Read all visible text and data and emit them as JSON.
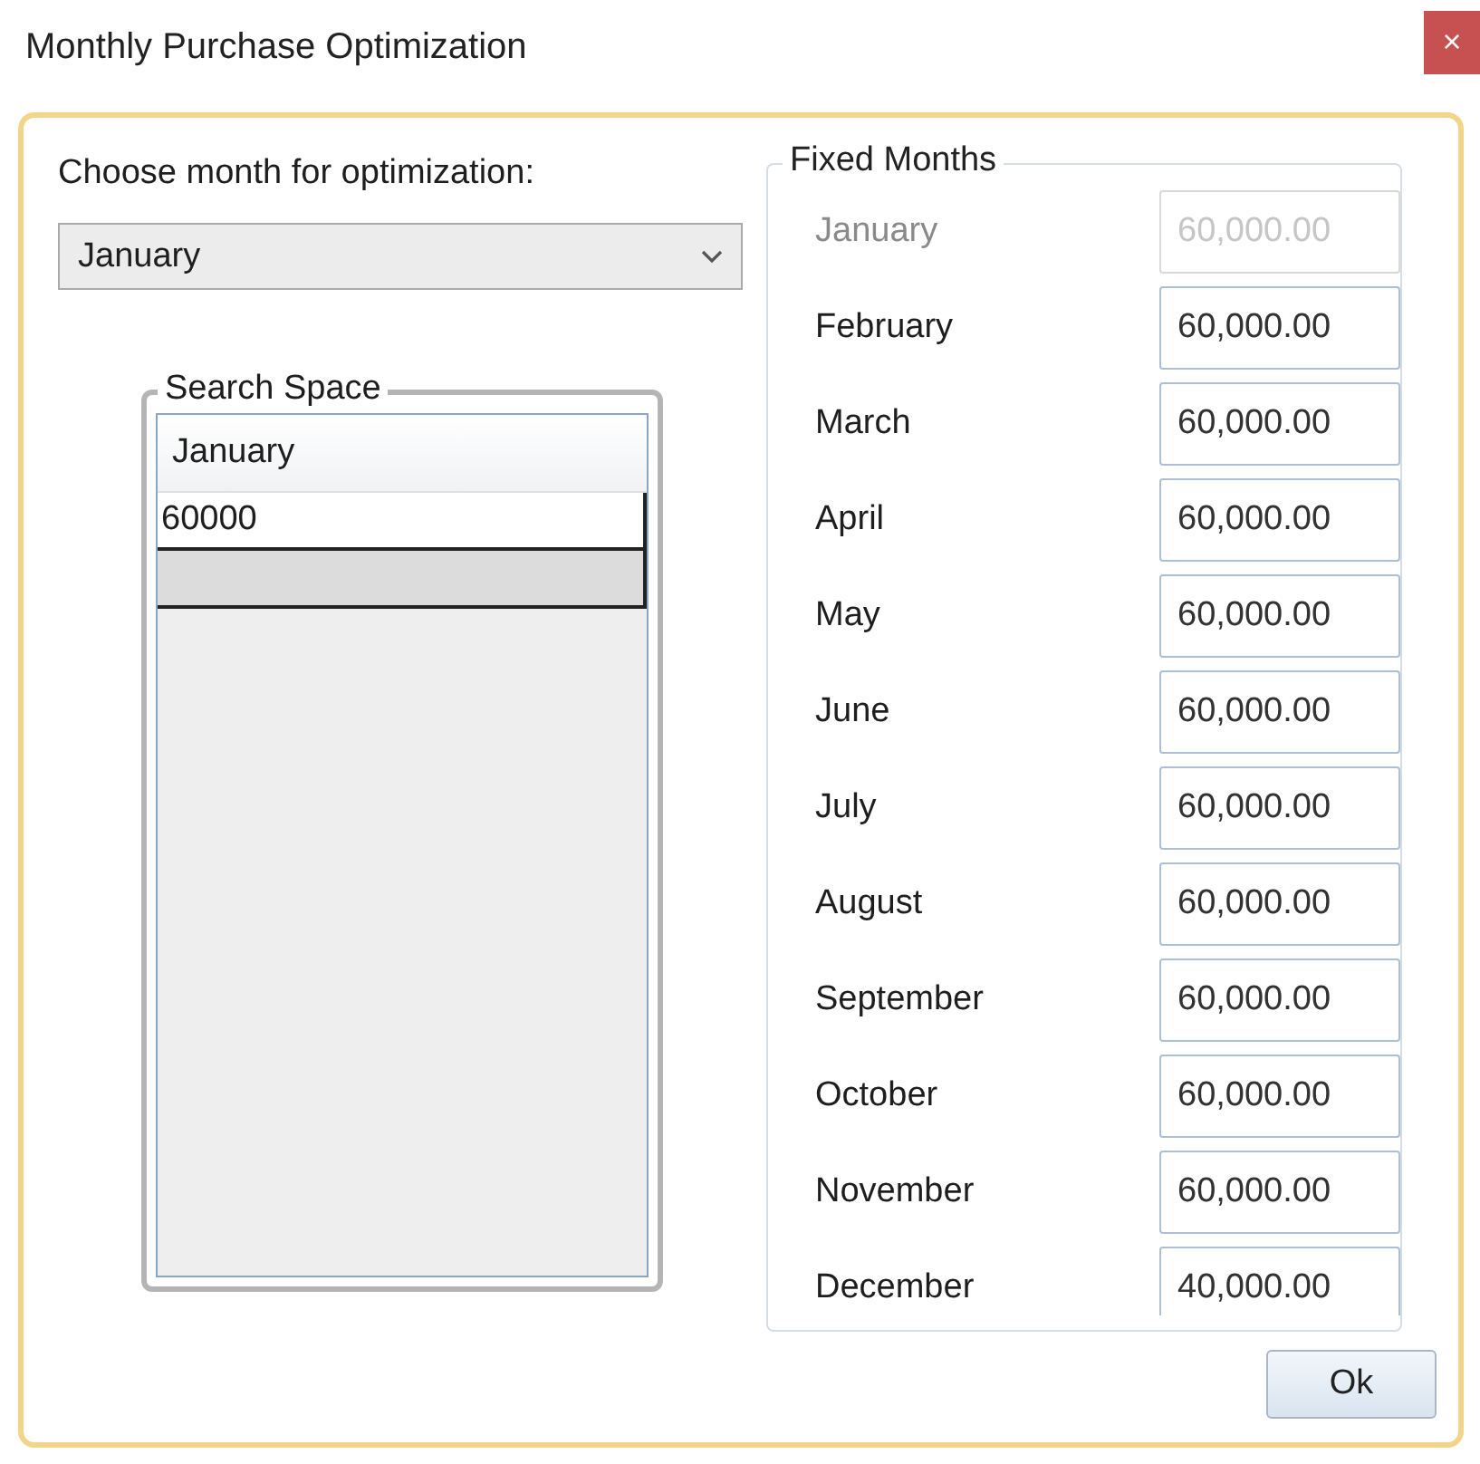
{
  "window": {
    "title": "Monthly Purchase Optimization",
    "close_label": "×"
  },
  "month_prompt": "Choose month for optimization:",
  "month_dropdown": {
    "value": "January"
  },
  "search_space": {
    "title": "Search Space",
    "columns": [
      "January"
    ],
    "rows": [
      [
        "60000"
      ]
    ]
  },
  "fixed_months": {
    "title": "Fixed Months",
    "items": [
      {
        "label": "January",
        "value": "60,000.00",
        "disabled": true
      },
      {
        "label": "February",
        "value": "60,000.00",
        "disabled": false
      },
      {
        "label": "March",
        "value": "60,000.00",
        "disabled": false
      },
      {
        "label": "April",
        "value": "60,000.00",
        "disabled": false
      },
      {
        "label": "May",
        "value": "60,000.00",
        "disabled": false
      },
      {
        "label": "June",
        "value": "60,000.00",
        "disabled": false
      },
      {
        "label": "July",
        "value": "60,000.00",
        "disabled": false
      },
      {
        "label": "August",
        "value": "60,000.00",
        "disabled": false
      },
      {
        "label": "September",
        "value": "60,000.00",
        "disabled": false
      },
      {
        "label": "October",
        "value": "60,000.00",
        "disabled": false
      },
      {
        "label": "November",
        "value": "60,000.00",
        "disabled": false
      },
      {
        "label": "December",
        "value": "40,000.00",
        "disabled": false
      }
    ]
  },
  "buttons": [
    "Ok"
  ]
}
